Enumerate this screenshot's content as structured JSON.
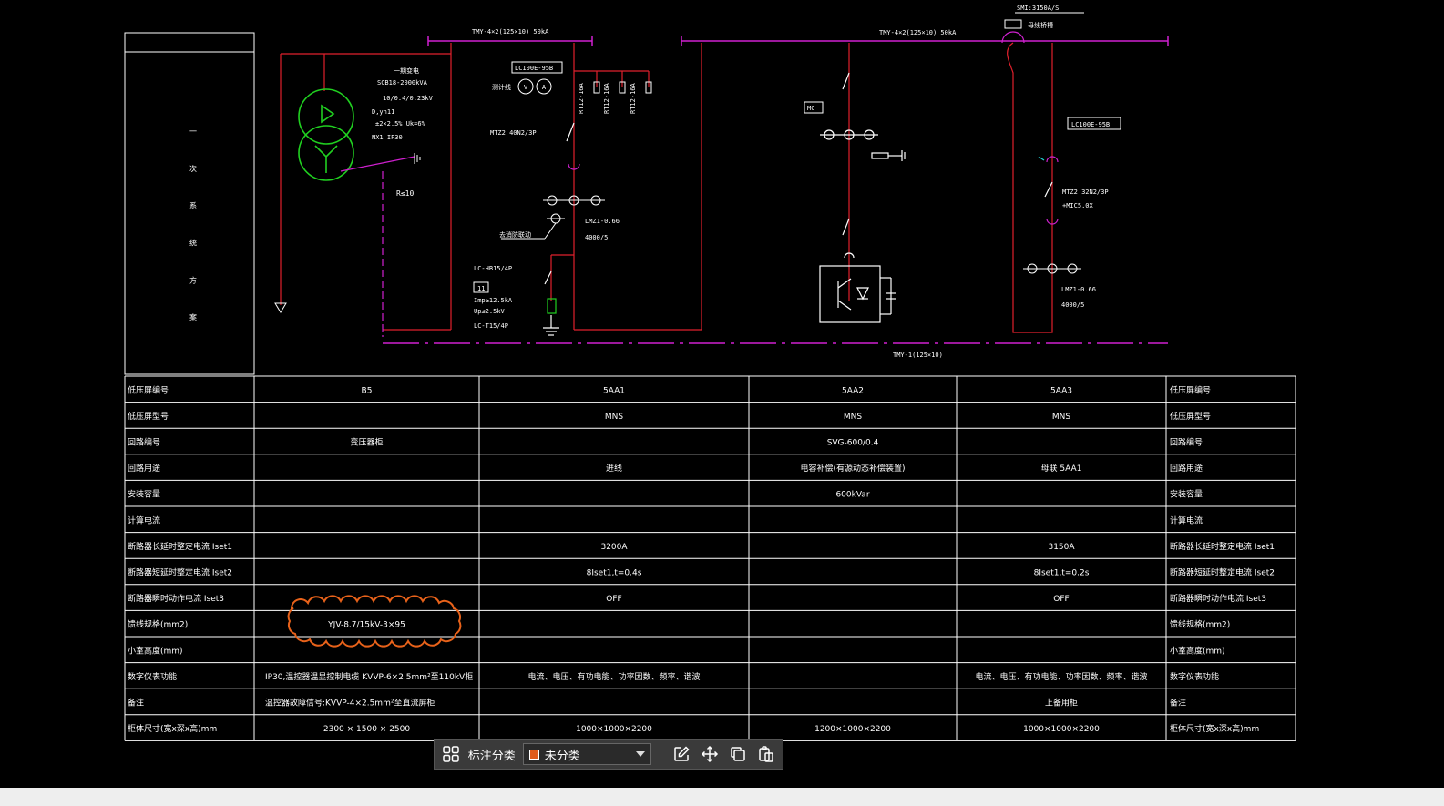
{
  "colors": {
    "busbar": "#d020d0",
    "wire": "#e0202c",
    "transformer": "#20d020",
    "text": "#ffffff",
    "table": "#ffffff",
    "revision_cloud": "#e8621a",
    "toolbar_bg": "#3a3a3a",
    "category_swatch": "#e05a1a"
  },
  "schematic": {
    "bus_left_label": "TMY-4×2(125×10) 50kA",
    "bus_right_label": "TMY-4×2(125×10) 50kA",
    "bottom_bus_label": "TMY-1(125×10)",
    "smi_label": "SMI:3150A/S",
    "busbar_duct_label": "母线桥槽",
    "title_vertical": "一 次 系 统 方 案",
    "transformer": {
      "lines": [
        "一期变电",
        "SCB18-2000kVA",
        "10/0.4/0.23kV",
        "D,yn11",
        "±2×2.5% Uk=6%",
        "NX1 IP30"
      ],
      "ground_label": "R≤10"
    },
    "incoming": {
      "meter_tag": "LC100E-95B",
      "meter_label": "测计线",
      "meter_v": "V",
      "meter_a": "A",
      "breaker": "MTZ2 40N2/3P",
      "ct": "LMZ1-0.66",
      "ct_ratio": "4000/5",
      "spd_model": "LC-HB15/4P",
      "spd_num": "11",
      "spd_imp": "Imp≥12.5kA",
      "spd_up": "Up≤2.5kV",
      "spd_model2": "LC-T15/4P",
      "feeder_note": "去消防联动",
      "fuse1": "RT12-16A",
      "fuse2": "RT12-16A",
      "fuse3": "RT12-16A"
    },
    "svg_panel": {
      "mc_tag": "MC"
    },
    "outgoing": {
      "meter_tag": "LC100E-95B",
      "breaker": "MTZ2 32N2/3P",
      "trip": "+MIC5.0X",
      "ct": "LMZ1-0.66",
      "ct_ratio": "4000/5"
    }
  },
  "table": {
    "left_headers": [
      "低压屏编号",
      "低压屏型号",
      "回路编号",
      "回路用途",
      "安装容量",
      "计算电流",
      "断路器长延时整定电流 Iset1",
      "断路器短延时整定电流 Iset2",
      "断路器瞬时动作电流  Iset3",
      "馈线规格(mm2)",
      "小室高度(mm)",
      "数字仪表功能",
      "备注",
      "柜体尺寸(宽x深x高)mm"
    ],
    "right_headers": [
      "低压屏编号",
      "低压屏型号",
      "回路编号",
      "回路用途",
      "安装容量",
      "计算电流",
      "断路器长延时整定电流 Iset1",
      "断路器短延时整定电流 Iset2",
      "断路器瞬时动作电流  Iset3",
      "馈线规格(mm2)",
      "小室高度(mm)",
      "数字仪表功能",
      "备注",
      "柜体尺寸(宽x深x高)mm"
    ],
    "columns": [
      [
        "B5",
        "",
        "变压器柜",
        "",
        "",
        "",
        "",
        "",
        "",
        "YJV-8.7/15kV-3×95",
        "",
        "IP30,温控器温显控制电缆 KVVP-6×2.5mm²至110kV柜",
        "温控器故障信号:KVVP-4×2.5mm²至直流屏柜",
        "2300 × 1500 × 2500"
      ],
      [
        "5AA1",
        "MNS",
        "",
        "进线",
        "",
        "",
        "3200A",
        "8Iset1,t=0.4s",
        "OFF",
        "",
        "",
        "电流、电压、有功电能、功率因数、频率、谐波",
        "",
        "1000×1000×2200"
      ],
      [
        "5AA2",
        "MNS",
        "SVG-600/0.4",
        "电容补偿(有源动态补偿装置)",
        "600kVar",
        "",
        "",
        "",
        "",
        "",
        "",
        "",
        "",
        "1200×1000×2200"
      ],
      [
        "5AA3",
        "MNS",
        "",
        "母联 5AA1",
        "",
        "",
        "3150A",
        "8Iset1,t=0.2s",
        "OFF",
        "",
        "",
        "电流、电压、有功电能、功率因数、频率、谐波",
        "上备用柜",
        "1000×1000×2200"
      ]
    ]
  },
  "toolbar": {
    "label": "标注分类",
    "category_value": "未分类",
    "grid_icon": "grid-icon",
    "edit_icon": "edit-icon",
    "move_icon": "move-icon",
    "copy_icon": "copy-icon",
    "paste_icon": "paste-icon"
  }
}
